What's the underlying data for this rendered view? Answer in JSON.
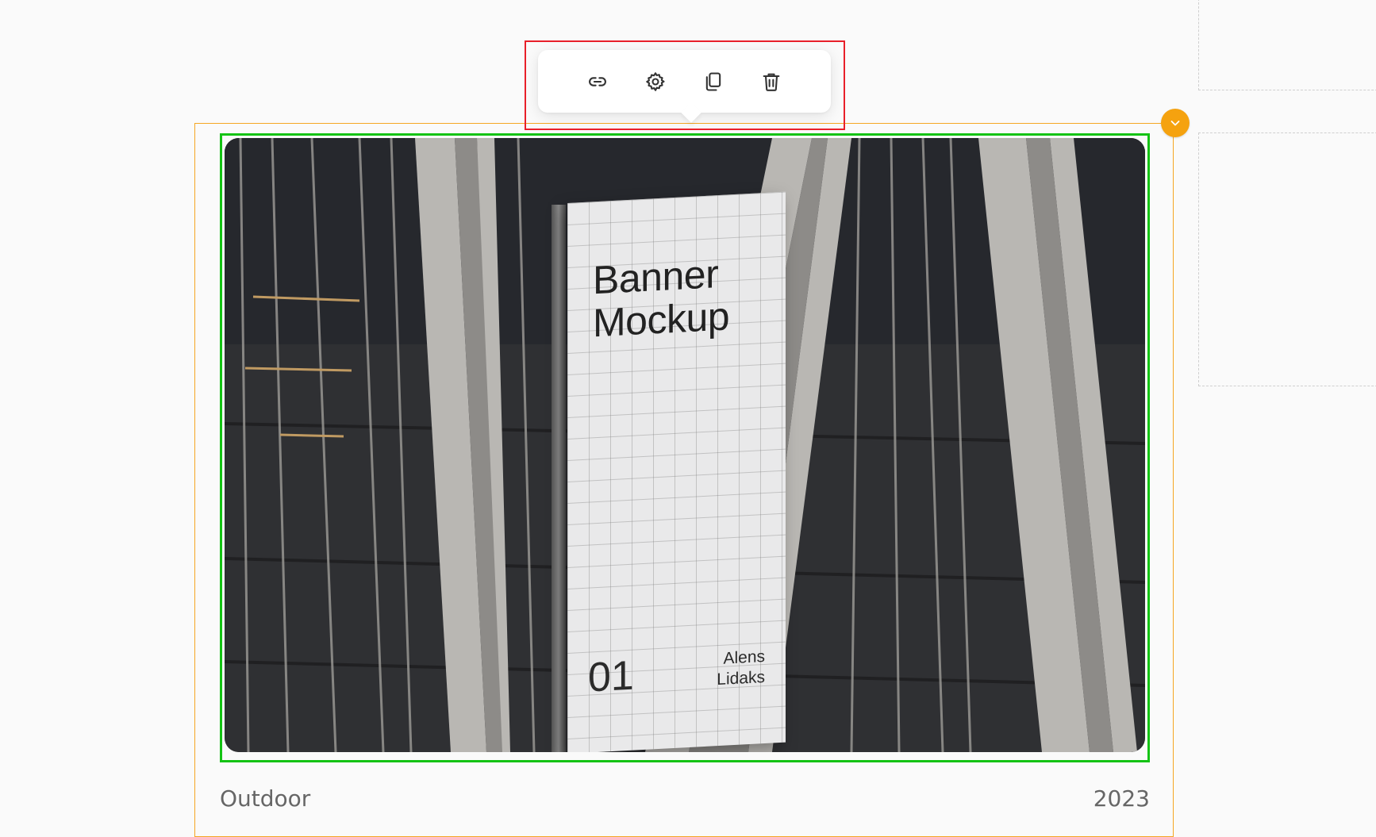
{
  "toolbar": {
    "buttons": [
      {
        "icon": "link-icon",
        "label": "Link"
      },
      {
        "icon": "gear-icon",
        "label": "Settings"
      },
      {
        "icon": "copy-icon",
        "label": "Duplicate"
      },
      {
        "icon": "trash-icon",
        "label": "Delete"
      }
    ]
  },
  "card": {
    "image": {
      "banner_title_line1": "Banner",
      "banner_title_line2": "Mockup",
      "banner_number": "01",
      "banner_author_line1": "Alens",
      "banner_author_line2": "Lidaks"
    },
    "category": "Outdoor",
    "year": "2023"
  },
  "colors": {
    "selection_outline": "#f5a623",
    "image_highlight": "#14c314",
    "toolbar_highlight": "#e8202a",
    "background": "#fafafa"
  }
}
